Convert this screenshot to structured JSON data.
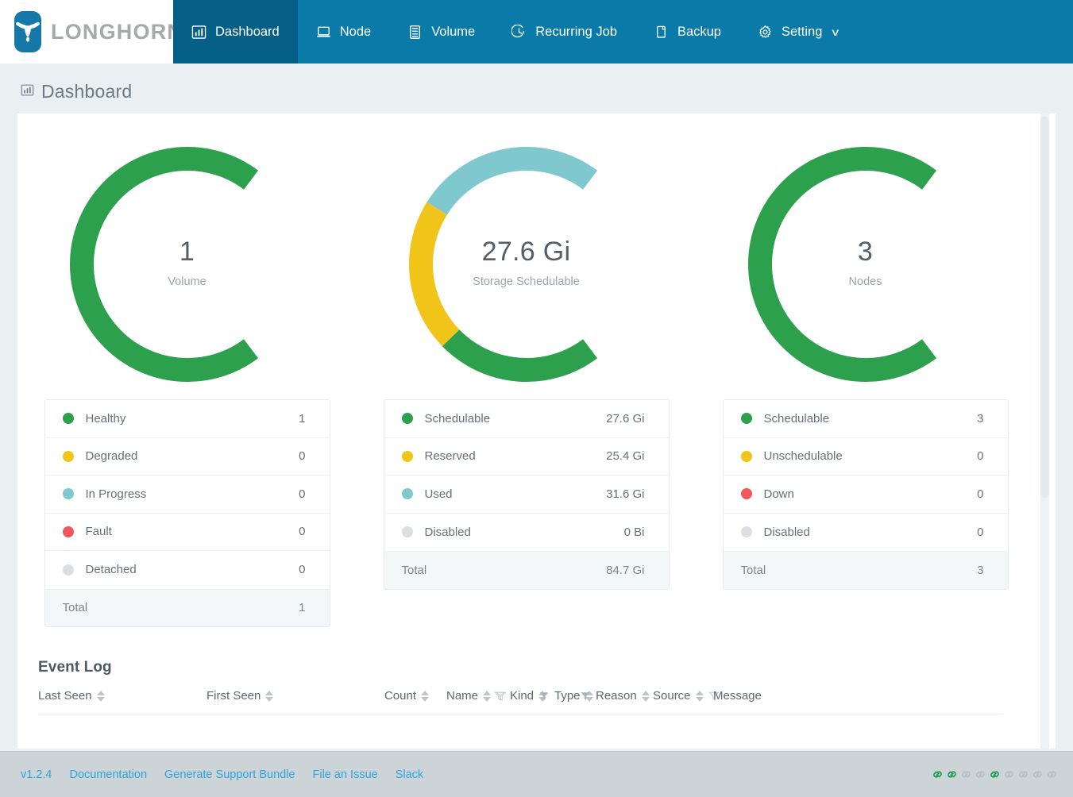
{
  "brand": {
    "name": "LONGHORN",
    "icon": "longhorn-bull-icon"
  },
  "nav": {
    "items": [
      {
        "label": "Dashboard",
        "icon": "bar-chart-icon",
        "active": true
      },
      {
        "label": "Node",
        "icon": "laptop-icon",
        "active": false
      },
      {
        "label": "Volume",
        "icon": "server-icon",
        "active": false
      },
      {
        "label": "Recurring Job",
        "icon": "clock-icon",
        "active": false
      },
      {
        "label": "Backup",
        "icon": "copy-icon",
        "active": false
      },
      {
        "label": "Setting",
        "icon": "gear-icon",
        "active": false,
        "caret": "∨"
      }
    ]
  },
  "page": {
    "title": "Dashboard",
    "title_icon": "bar-chart-icon"
  },
  "colors": {
    "green": "#2ca04c",
    "yellow": "#f0c419",
    "teal": "#7ec8ce",
    "red": "#f2575c",
    "gray": "#dcdfe1",
    "brand_blue": "#0a7ba8",
    "active_blue": "#065f86",
    "link_blue": "#2ea3dd"
  },
  "gauges": [
    {
      "name": "volume-gauge",
      "value": "1",
      "label": "Volume",
      "segments": [
        {
          "key": "healthy",
          "color": "#2ca04c",
          "fraction": 1.0
        }
      ]
    },
    {
      "name": "storage-gauge",
      "value": "27.6 Gi",
      "label": "Storage Schedulable",
      "segments": [
        {
          "key": "schedulable",
          "color": "#2ca04c",
          "fraction": 0.326
        },
        {
          "key": "reserved",
          "color": "#f0c419",
          "fraction": 0.3
        },
        {
          "key": "used",
          "color": "#7ec8ce",
          "fraction": 0.374
        }
      ]
    },
    {
      "name": "nodes-gauge",
      "value": "3",
      "label": "Nodes",
      "segments": [
        {
          "key": "schedulable",
          "color": "#2ca04c",
          "fraction": 1.0
        }
      ]
    }
  ],
  "legends": [
    {
      "name": "volume-legend",
      "rows": [
        {
          "label": "Healthy",
          "value": "1",
          "color": "#2ca04c"
        },
        {
          "label": "Degraded",
          "value": "0",
          "color": "#f0c419"
        },
        {
          "label": "In Progress",
          "value": "0",
          "color": "#7ec8ce"
        },
        {
          "label": "Fault",
          "value": "0",
          "color": "#f2575c"
        },
        {
          "label": "Detached",
          "value": "0",
          "color": "#dcdfe1"
        }
      ],
      "total": {
        "label": "Total",
        "value": "1"
      }
    },
    {
      "name": "storage-legend",
      "rows": [
        {
          "label": "Schedulable",
          "value": "27.6 Gi",
          "color": "#2ca04c"
        },
        {
          "label": "Reserved",
          "value": "25.4 Gi",
          "color": "#f0c419"
        },
        {
          "label": "Used",
          "value": "31.6 Gi",
          "color": "#7ec8ce"
        },
        {
          "label": "Disabled",
          "value": "0 Bi",
          "color": "#dcdfe1"
        }
      ],
      "total": {
        "label": "Total",
        "value": "84.7 Gi"
      }
    },
    {
      "name": "nodes-legend",
      "rows": [
        {
          "label": "Schedulable",
          "value": "3",
          "color": "#2ca04c"
        },
        {
          "label": "Unschedulable",
          "value": "0",
          "color": "#f0c419"
        },
        {
          "label": "Down",
          "value": "0",
          "color": "#f2575c"
        },
        {
          "label": "Disabled",
          "value": "0",
          "color": "#dcdfe1"
        }
      ],
      "total": {
        "label": "Total",
        "value": "3"
      }
    }
  ],
  "event_log": {
    "title": "Event Log",
    "columns": [
      {
        "label": "Last Seen",
        "sortable": true,
        "filter": "none"
      },
      {
        "label": "First Seen",
        "sortable": true,
        "filter": "none"
      },
      {
        "label": "Count",
        "sortable": true,
        "filter": "none"
      },
      {
        "label": "Name",
        "sortable": true,
        "filter": "outline"
      },
      {
        "label": "Kind",
        "sortable": true,
        "filter": "leading-outline"
      },
      {
        "label": "Type",
        "sortable": true,
        "filter": "leading-solid"
      },
      {
        "label": "Reason",
        "sortable": true,
        "filter": "leading-solid"
      },
      {
        "label": "Source",
        "sortable": true,
        "filter": "outline"
      },
      {
        "label": "Message",
        "sortable": false,
        "filter": "none"
      }
    ],
    "rows": []
  },
  "footer": {
    "version": "v1.2.4",
    "links": [
      {
        "label": "Documentation"
      },
      {
        "label": "Generate Support Bundle"
      },
      {
        "label": "File an Issue"
      },
      {
        "label": "Slack"
      }
    ],
    "status_links": [
      {
        "state": "on"
      },
      {
        "state": "on"
      },
      {
        "state": "off"
      },
      {
        "state": "off"
      },
      {
        "state": "on"
      },
      {
        "state": "off"
      },
      {
        "state": "off"
      },
      {
        "state": "off"
      },
      {
        "state": "off"
      }
    ],
    "link_on_color": "#1e9c4e",
    "link_off_color": "#b6bec3"
  }
}
